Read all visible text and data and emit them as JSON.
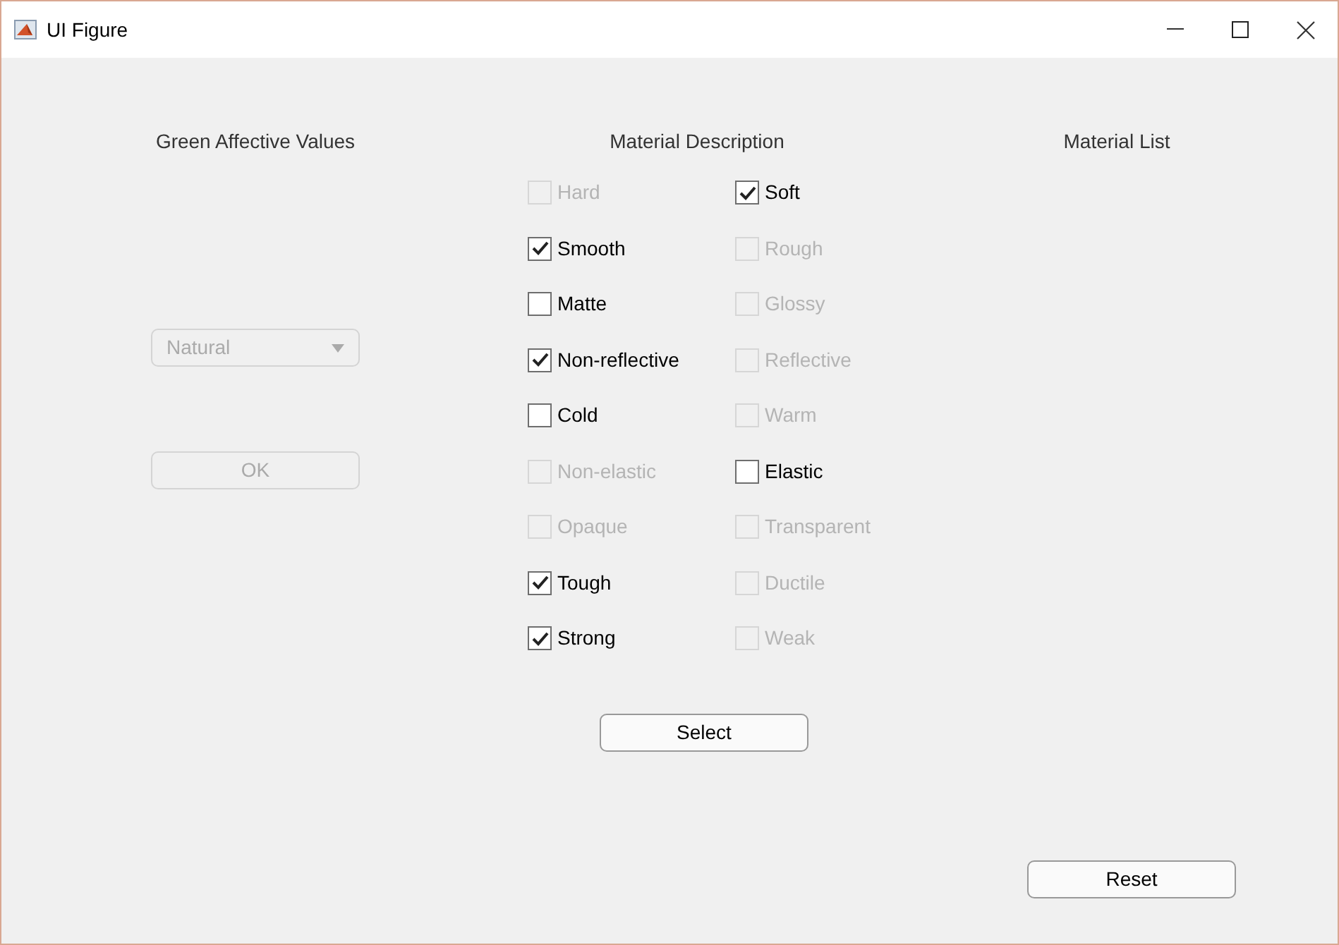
{
  "window": {
    "title": "UI Figure"
  },
  "left": {
    "heading": "Green Affective Values",
    "dropdown": {
      "value": "Natural",
      "disabled": true
    },
    "ok_button": {
      "label": "OK",
      "disabled": true
    }
  },
  "middle": {
    "heading": "Material Description",
    "rows": [
      [
        {
          "label": "Hard",
          "checked": false,
          "disabled": true
        },
        {
          "label": "Soft",
          "checked": true,
          "disabled": false
        }
      ],
      [
        {
          "label": "Smooth",
          "checked": true,
          "disabled": false
        },
        {
          "label": "Rough",
          "checked": false,
          "disabled": true
        }
      ],
      [
        {
          "label": "Matte",
          "checked": false,
          "disabled": false
        },
        {
          "label": "Glossy",
          "checked": false,
          "disabled": true
        }
      ],
      [
        {
          "label": "Non-reflective",
          "checked": true,
          "disabled": false
        },
        {
          "label": "Reflective",
          "checked": false,
          "disabled": true
        }
      ],
      [
        {
          "label": "Cold",
          "checked": false,
          "disabled": false
        },
        {
          "label": "Warm",
          "checked": false,
          "disabled": true
        }
      ],
      [
        {
          "label": "Non-elastic",
          "checked": false,
          "disabled": true
        },
        {
          "label": "Elastic",
          "checked": false,
          "disabled": false
        }
      ],
      [
        {
          "label": "Opaque",
          "checked": false,
          "disabled": true
        },
        {
          "label": "Transparent",
          "checked": false,
          "disabled": true
        }
      ],
      [
        {
          "label": "Tough",
          "checked": true,
          "disabled": false
        },
        {
          "label": "Ductile",
          "checked": false,
          "disabled": true
        }
      ],
      [
        {
          "label": "Strong",
          "checked": true,
          "disabled": false
        },
        {
          "label": "Weak",
          "checked": false,
          "disabled": true
        }
      ]
    ],
    "select_button": {
      "label": "Select"
    }
  },
  "right": {
    "heading": "Material List",
    "reset_button": {
      "label": "Reset"
    }
  }
}
